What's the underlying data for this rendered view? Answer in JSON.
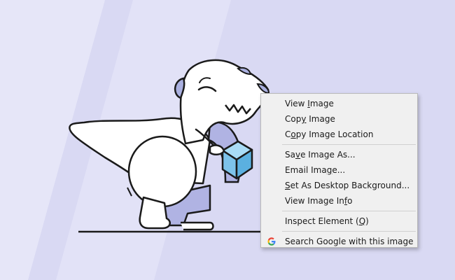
{
  "context_menu": {
    "items": [
      {
        "before": "View ",
        "key": "I",
        "after": "mage"
      },
      {
        "before": "Cop",
        "key": "y",
        "after": " Image"
      },
      {
        "before": "C",
        "key": "o",
        "after": "py Image Location"
      },
      {
        "before": "Sa",
        "key": "v",
        "after": "e Image As..."
      },
      {
        "before": "Email Ima",
        "key": "g",
        "after": "e..."
      },
      {
        "before": "",
        "key": "S",
        "after": "et As Desktop Background..."
      },
      {
        "before": "View Image In",
        "key": "f",
        "after": "o"
      },
      {
        "before": "Inspect Element (",
        "key": "Q",
        "after": ")"
      },
      {
        "before": "Search Google with this image",
        "key": "",
        "after": ""
      }
    ]
  },
  "colors": {
    "background": "#d9d9f3",
    "menu_background": "#f0f0f0",
    "dino_accent": "#aab0e0",
    "box_blue": "#7dc3ea"
  },
  "icons": [
    "google-icon"
  ]
}
